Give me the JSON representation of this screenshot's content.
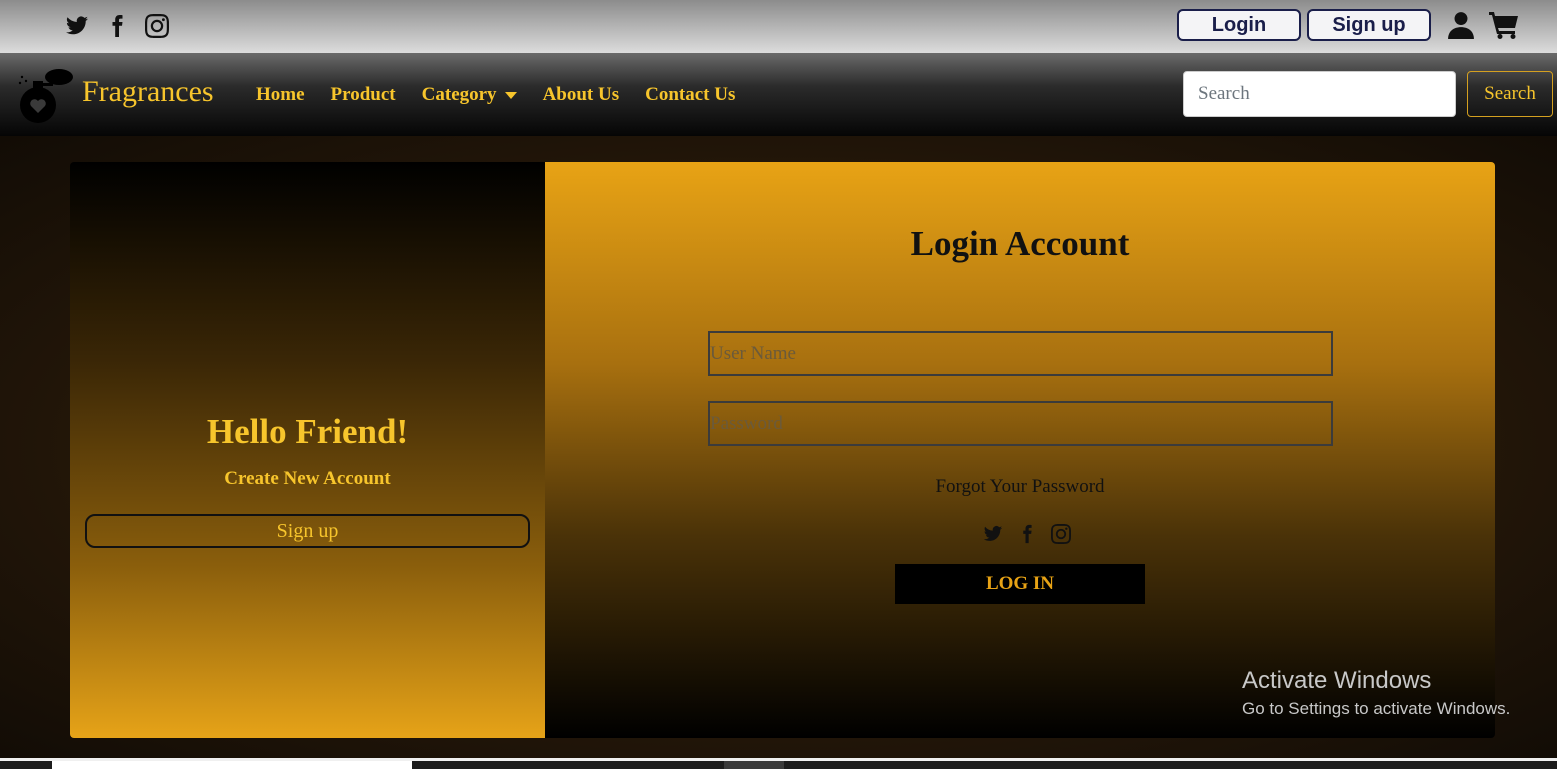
{
  "topbar": {
    "social_icons": [
      "twitter-icon",
      "facebook-icon",
      "instagram-icon"
    ],
    "login_label": "Login",
    "signup_label": "Sign up",
    "user_icon": "user-icon",
    "cart_icon": "cart-icon"
  },
  "navbar": {
    "brand": "Fragrances",
    "logo_icon": "perfume-bottle-icon",
    "links": [
      {
        "label": "Home"
      },
      {
        "label": "Product"
      },
      {
        "label": "Category"
      },
      {
        "label": "About Us"
      },
      {
        "label": "Contact Us"
      }
    ],
    "search_placeholder": "Search",
    "search_button": "Search"
  },
  "left_panel": {
    "greeting": "Hello Friend!",
    "subtitle": "Create New Account",
    "signup_button": "Sign up"
  },
  "right_panel": {
    "title": "Login Account",
    "username_placeholder": "User Name",
    "password_placeholder": "Password",
    "forgot_link": "Forgot Your Password",
    "social_icons": [
      "twitter-icon",
      "facebook-icon",
      "instagram-icon"
    ],
    "login_button": "LOG IN"
  },
  "watermark": {
    "title": "Activate Windows",
    "subtitle": "Go to Settings to activate Windows."
  },
  "colors": {
    "accent": "#f7c52c",
    "gold": "#e8a315",
    "navy": "#1a1e4a"
  }
}
